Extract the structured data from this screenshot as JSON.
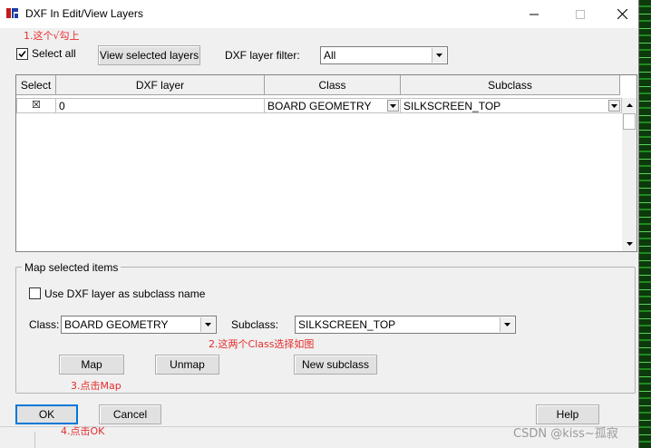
{
  "window": {
    "title": "DXF In Edit/View Layers",
    "minimize_icon": "minimize-icon",
    "maximize_icon": "maximize-icon",
    "close_icon": "close-icon"
  },
  "annotations": {
    "step1": "1.这个√勾上",
    "step2": "2.这两个Class选择如图",
    "step3": "3.点击Map",
    "step4": "4.点击OK"
  },
  "toolbar": {
    "select_all_label": "Select all",
    "select_all_checked": true,
    "view_selected_label": "View selected layers",
    "filter_label": "DXF layer filter:",
    "filter_value": "All"
  },
  "grid": {
    "columns": [
      "Select",
      "DXF layer",
      "Class",
      "Subclass"
    ],
    "rows": [
      {
        "select": "☒",
        "dxf_layer": "0",
        "class": "BOARD GEOMETRY",
        "subclass": "SILKSCREEN_TOP"
      }
    ]
  },
  "map_group": {
    "title": "Map selected items",
    "use_dxf_label": "Use DXF layer as subclass name",
    "use_dxf_checked": false,
    "class_label": "Class:",
    "class_value": "BOARD GEOMETRY",
    "subclass_label": "Subclass:",
    "subclass_value": "SILKSCREEN_TOP",
    "map_button": "Map",
    "unmap_button": "Unmap",
    "new_subclass_button": "New subclass"
  },
  "footer": {
    "ok_button": "OK",
    "cancel_button": "Cancel",
    "help_button": "Help"
  },
  "watermark": "CSDN @kiss~孤寂",
  "colors": {
    "annotation": "#e62d2d",
    "dialog_bg": "#f0f0f0",
    "titlebar_bg": "#ffffff"
  }
}
